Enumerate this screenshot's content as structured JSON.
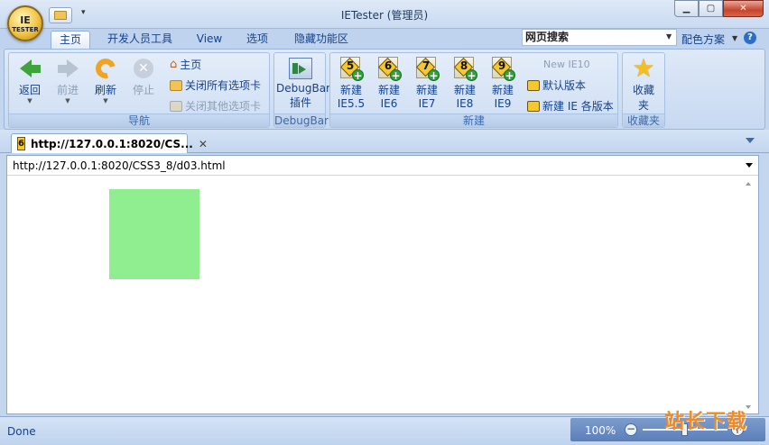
{
  "window": {
    "title": "IETester (管理员)",
    "orb_small": "IE",
    "orb_caption": "TESTER",
    "qat_dropdown": "▾"
  },
  "ribbon_tabs": [
    {
      "label": "主页"
    },
    {
      "label": "开发人员工具"
    },
    {
      "label": "View"
    },
    {
      "label": "选项"
    },
    {
      "label": "隐藏功能区"
    }
  ],
  "search": {
    "value": "网页搜索"
  },
  "color_scheme": "配色方案",
  "help": "?",
  "groups": {
    "nav": {
      "label": "导航",
      "back": "返回",
      "forward": "前进",
      "refresh": "刷新",
      "stop": "停止",
      "home": "主页",
      "close_all": "关闭所有选项卡",
      "close_others": "关闭其他选项卡"
    },
    "debugbar": {
      "label": "DebugBar",
      "button_line1": "DebugBar",
      "button_line2": "插件"
    },
    "new": {
      "label": "新建",
      "items": [
        {
          "num": "5",
          "line1": "新建",
          "line2": "IE5.5"
        },
        {
          "num": "6",
          "line1": "新建",
          "line2": "IE6"
        },
        {
          "num": "7",
          "line1": "新建",
          "line2": "IE7"
        },
        {
          "num": "8",
          "line1": "新建",
          "line2": "IE8"
        },
        {
          "num": "9",
          "line1": "新建",
          "line2": "IE9"
        }
      ],
      "new_ie10": "New IE10",
      "default_version": "默认版本",
      "new_all": "新建 IE 各版本"
    },
    "favorites": {
      "label": "收藏夹",
      "button": "收藏夹"
    }
  },
  "doc_tab": {
    "title": "http://127.0.0.1:8020/CS...",
    "close": "✕",
    "icon_num": "6"
  },
  "address": {
    "url": "http://127.0.0.1:8020/CSS3_8/d03.html"
  },
  "page": {
    "box_color": "#90ee90"
  },
  "status": {
    "text": "Done",
    "zoom": "100%",
    "zoom_level": 0.5
  },
  "watermark": "站长下载"
}
